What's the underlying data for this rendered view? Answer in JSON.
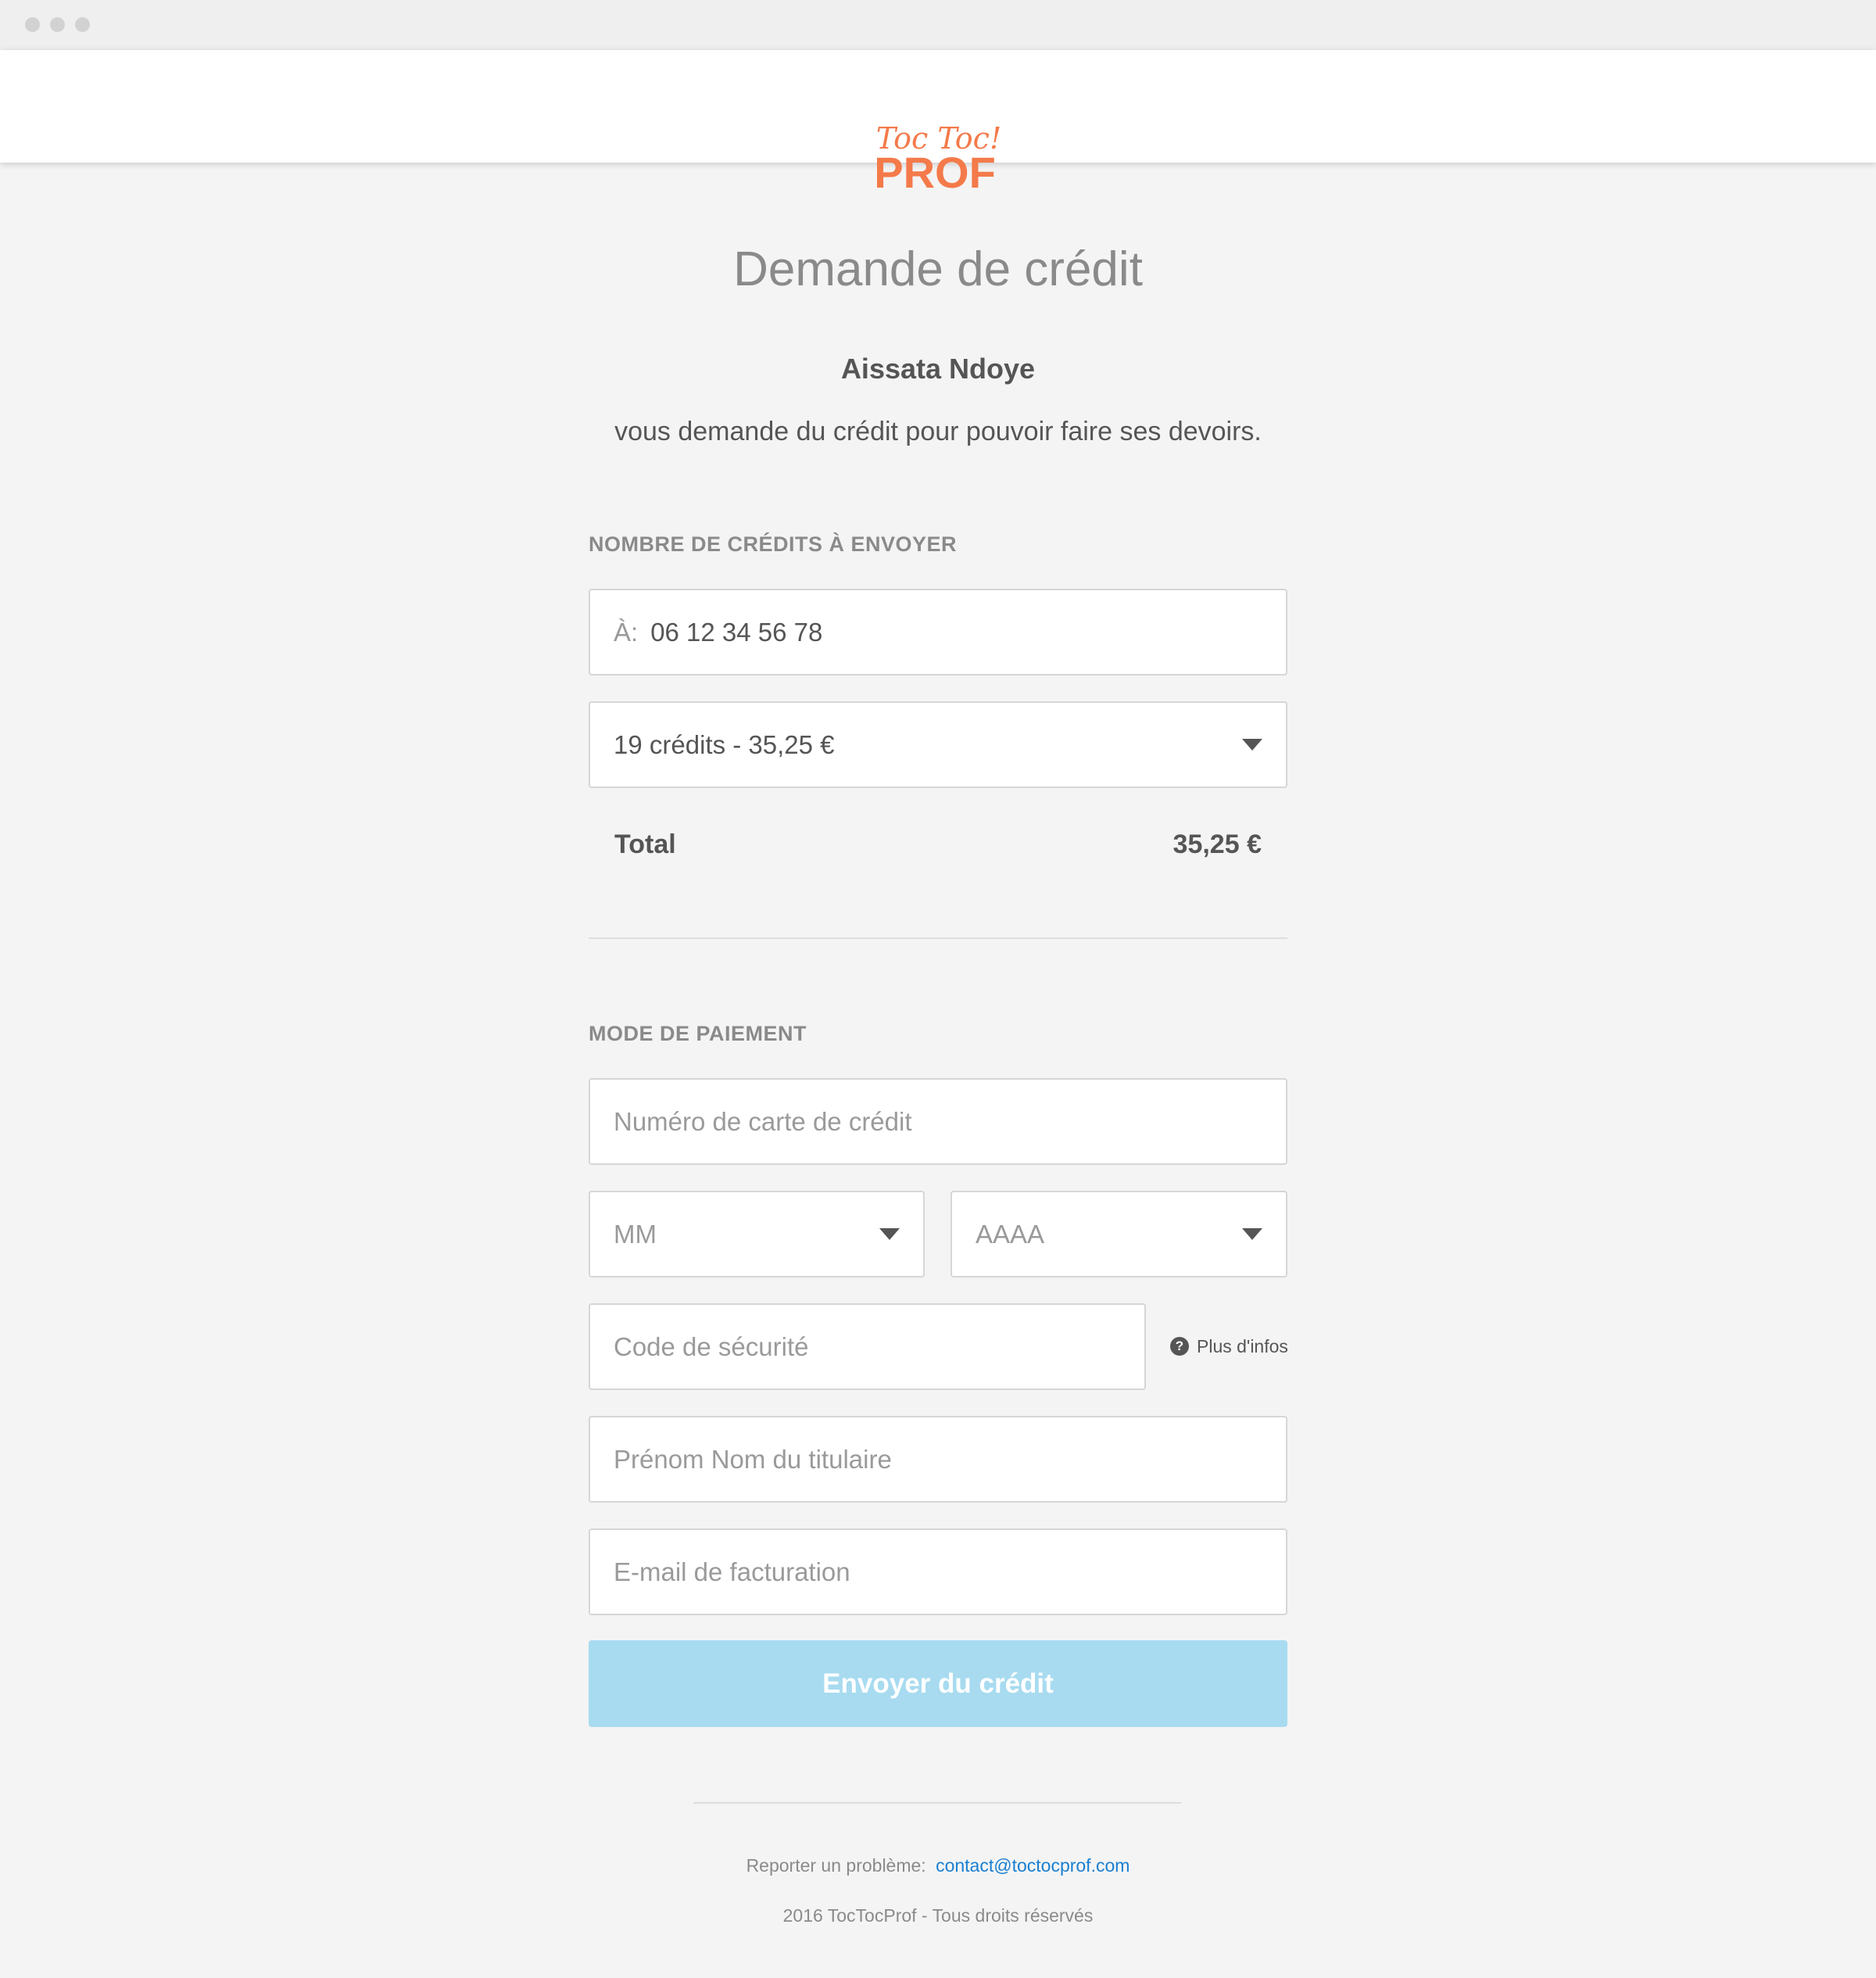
{
  "brand": {
    "logo_line1": "Toc Toc!",
    "logo_line2": "PROF",
    "logo_color": "#f47a4a"
  },
  "page": {
    "title": "Demande de crédit",
    "requester_name": "Aissata Ndoye",
    "message": "vous demande du crédit pour pouvoir faire ses devoirs."
  },
  "credits_section": {
    "label": "NOMBRE DE CRÉDITS À ENVOYER",
    "recipient_prefix": "À:",
    "recipient_value": "06 12 34 56 78",
    "credit_option_selected": "19 crédits - 35,25 €",
    "total_label": "Total",
    "total_value": "35,25 €"
  },
  "payment_section": {
    "label": "MODE DE PAIEMENT",
    "card_number_placeholder": "Numéro de carte de crédit",
    "month_placeholder": "MM",
    "year_placeholder": "AAAA",
    "security_code_placeholder": "Code de sécurité",
    "help_icon_glyph": "?",
    "help_link_label": "Plus d'infos",
    "cardholder_placeholder": "Prénom Nom du titulaire",
    "billing_email_placeholder": "E-mail de facturation",
    "submit_label": "Envoyer du crédit"
  },
  "footer": {
    "report_label": "Reporter un problème:",
    "contact_email": "contact@toctocprof.com",
    "copyright": "2016 TocTocProf - Tous droits réservés"
  },
  "colors": {
    "accent": "#f47a4a",
    "button_disabled": "#a8dbf0",
    "link": "#1a7fd1",
    "background": "#f4f4f4"
  },
  "icons": {
    "dropdown": "chevron-down-icon",
    "help": "question-circle-icon"
  }
}
